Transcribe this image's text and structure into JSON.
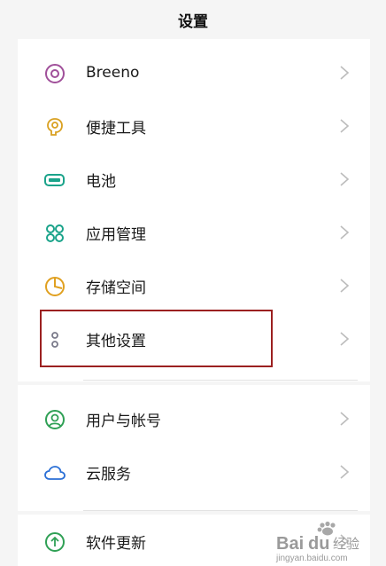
{
  "header": {
    "title": "设置"
  },
  "settings": [
    {
      "label": "Breeno",
      "icon": "breeno-icon",
      "color": "#a0509a"
    },
    {
      "label": "便捷工具",
      "icon": "convenience-tools-icon",
      "color": "#d9a020"
    },
    {
      "label": "电池",
      "icon": "battery-icon",
      "color": "#1aa38a"
    },
    {
      "label": "应用管理",
      "icon": "app-management-icon",
      "color": "#1aa38a"
    },
    {
      "label": "存储空间",
      "icon": "storage-icon",
      "color": "#e0a020"
    },
    {
      "label": "其他设置",
      "icon": "other-settings-icon",
      "color": "#7a7a8a"
    }
  ],
  "account": [
    {
      "label": "用户与帐号",
      "icon": "user-account-icon",
      "color": "#2fa055"
    },
    {
      "label": "云服务",
      "icon": "cloud-service-icon",
      "color": "#2a6fd6"
    }
  ],
  "update": [
    {
      "label": "软件更新",
      "icon": "software-update-icon",
      "color": "#2fa055"
    }
  ],
  "highlight_color": "#9b2020",
  "watermark": {
    "text": "Bai du 经验",
    "sub": "jingyan.baidu.com"
  }
}
